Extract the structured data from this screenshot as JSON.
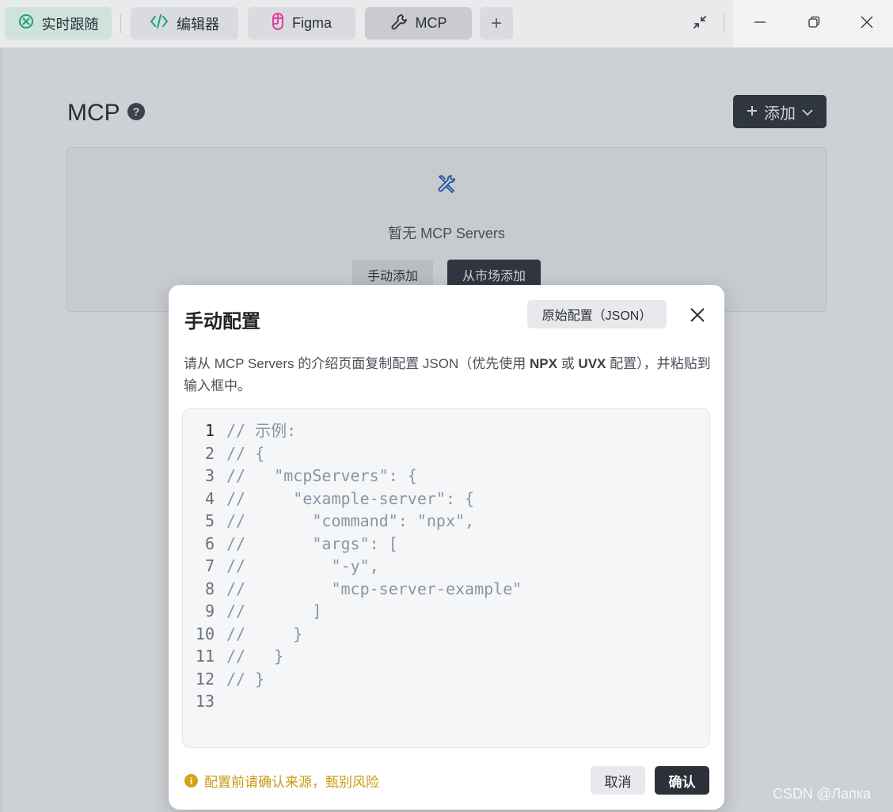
{
  "tabs": [
    {
      "label": "实时跟随",
      "icon": "target-icon"
    },
    {
      "label": "编辑器",
      "icon": "code-icon"
    },
    {
      "label": "Figma",
      "icon": "figma-icon"
    },
    {
      "label": "MCP",
      "icon": "wrench-icon",
      "active": true
    }
  ],
  "tab_add_label": "+",
  "page": {
    "title": "MCP",
    "help_label": "?",
    "add_button_label": "添加",
    "empty_text": "暂无 MCP Servers",
    "manual_add_label": "手动添加",
    "market_add_label": "从市场添加"
  },
  "modal": {
    "title": "手动配置",
    "raw_button_label": "原始配置（JSON）",
    "desc_part1": "请从 MCP Servers 的介绍页面复制配置 JSON（优先使用 ",
    "desc_npx": "NPX",
    "desc_or": " 或 ",
    "desc_uvx": "UVX",
    "desc_part2": " 配置），并粘贴到输入框中。",
    "code_lines": [
      {
        "num": "1",
        "text": "// 示例:"
      },
      {
        "num": "2",
        "text": "// {"
      },
      {
        "num": "3",
        "text": "//   \"mcpServers\": {"
      },
      {
        "num": "4",
        "text": "//     \"example-server\": {"
      },
      {
        "num": "5",
        "text": "//       \"command\": \"npx\","
      },
      {
        "num": "6",
        "text": "//       \"args\": ["
      },
      {
        "num": "7",
        "text": "//         \"-y\","
      },
      {
        "num": "8",
        "text": "//         \"mcp-server-example\""
      },
      {
        "num": "9",
        "text": "//       ]"
      },
      {
        "num": "10",
        "text": "//     }"
      },
      {
        "num": "11",
        "text": "//   }"
      },
      {
        "num": "12",
        "text": "// }"
      },
      {
        "num": "13",
        "text": ""
      }
    ],
    "warning_text": "配置前请确认来源，甄别风险",
    "warning_icon_label": "i",
    "cancel_label": "取消",
    "confirm_label": "确认"
  },
  "watermark": "CSDN @Лапка",
  "colors": {
    "primary_dark": "#2c3038",
    "warning": "#d4a216",
    "active_tab_green": "#1aa37a",
    "figma_pink": "#e0409a"
  }
}
